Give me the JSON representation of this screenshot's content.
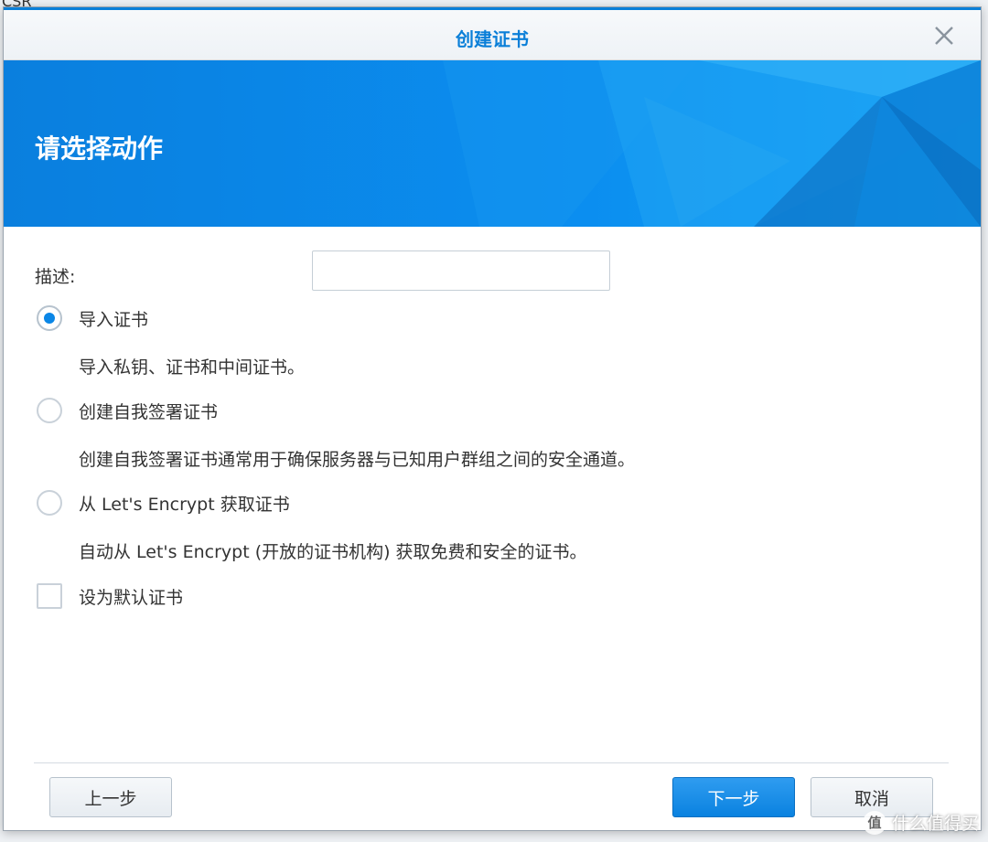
{
  "background": {
    "fragment_text": "CSR"
  },
  "dialog": {
    "title": "创建证书",
    "close_icon": "close-icon",
    "banner_heading": "请选择动作",
    "accent_color": "#0a86e6"
  },
  "form": {
    "description_label": "描述:",
    "description_value": "",
    "options": [
      {
        "label": "导入证书",
        "description": "导入私钥、证书和中间证书。",
        "selected": true
      },
      {
        "label": "创建自我签署证书",
        "description": "创建自我签署证书通常用于确保服务器与已知用户群组之间的安全通道。",
        "selected": false
      },
      {
        "label": "从 Let's Encrypt 获取证书",
        "description": "自动从 Let's Encrypt (开放的证书机构) 获取免费和安全的证书。",
        "selected": false
      }
    ],
    "default_checkbox_label": "设为默认证书",
    "default_checked": false
  },
  "footer": {
    "prev_label": "上一步",
    "next_label": "下一步",
    "cancel_label": "取消"
  },
  "watermark": {
    "icon_text": "值",
    "text": "什么值得买"
  }
}
